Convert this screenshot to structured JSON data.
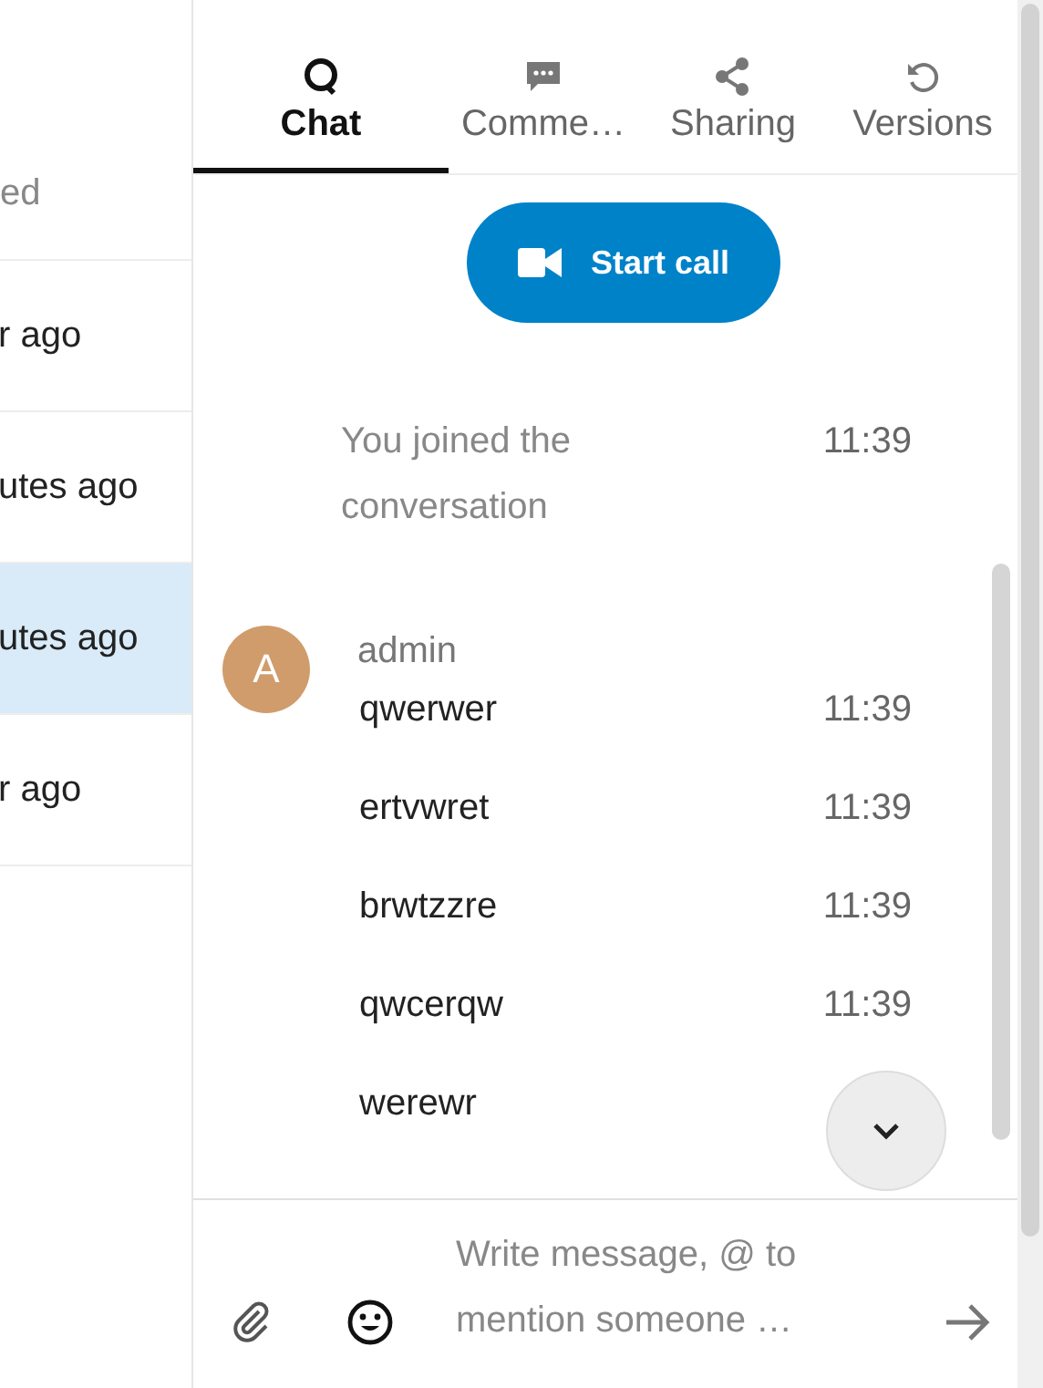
{
  "sidebar": {
    "header": "ed",
    "items": [
      {
        "label": "r ago",
        "selected": false
      },
      {
        "label": "utes ago",
        "selected": false
      },
      {
        "label": "utes ago",
        "selected": true
      },
      {
        "label": "r ago",
        "selected": false
      }
    ]
  },
  "tabs": [
    {
      "label": "Chat",
      "selected": true
    },
    {
      "label": "Comme…",
      "selected": false
    },
    {
      "label": "Sharing",
      "selected": false
    },
    {
      "label": "Versions",
      "selected": false
    }
  ],
  "start_call": {
    "label": "Start call"
  },
  "messages": [
    {
      "kind": "system",
      "text": "You joined the conversation",
      "time": "11:39"
    },
    {
      "kind": "author",
      "author": "admin",
      "avatar": "A",
      "color": "#d09c6b"
    },
    {
      "kind": "message",
      "text": "qwerwer",
      "time": "11:39"
    },
    {
      "kind": "message",
      "text": "ertvwret",
      "time": "11:39"
    },
    {
      "kind": "message",
      "text": "brwtzzre",
      "time": "11:39"
    },
    {
      "kind": "message",
      "text": "qwcerqw",
      "time": "11:39"
    },
    {
      "kind": "message",
      "text": "werewr"
    }
  ],
  "composer": {
    "placeholder": "Write message, @ to mention someone …"
  }
}
